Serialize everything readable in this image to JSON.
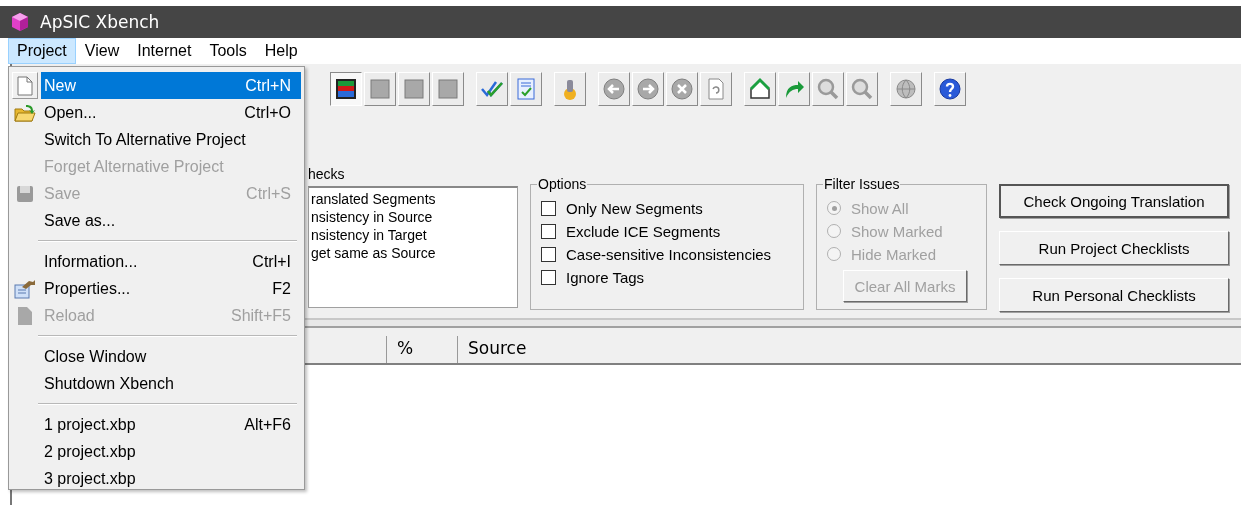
{
  "window": {
    "title": "ApSIC Xbench"
  },
  "menu_bar": [
    {
      "label": "Project",
      "selected": true
    },
    {
      "label": "View",
      "selected": false
    },
    {
      "label": "Internet",
      "selected": false
    },
    {
      "label": "Tools",
      "selected": false
    },
    {
      "label": "Help",
      "selected": false
    }
  ],
  "project_menu": [
    {
      "kind": "item",
      "label": "New",
      "shortcut": "Ctrl+N",
      "selected": true,
      "disabled": false
    },
    {
      "kind": "item",
      "label": "Open...",
      "shortcut": "Ctrl+O",
      "selected": false,
      "disabled": false
    },
    {
      "kind": "item",
      "label": "Switch To Alternative Project",
      "selected": false,
      "disabled": false
    },
    {
      "kind": "item",
      "label": "Forget Alternative Project",
      "selected": false,
      "disabled": true
    },
    {
      "kind": "item",
      "label": "Save",
      "shortcut": "Ctrl+S",
      "selected": false,
      "disabled": true
    },
    {
      "kind": "item",
      "label": "Save as...",
      "selected": false,
      "disabled": false
    },
    {
      "kind": "separator"
    },
    {
      "kind": "item",
      "label": "Information...",
      "shortcut": "Ctrl+I",
      "selected": false,
      "disabled": false
    },
    {
      "kind": "item",
      "label": "Properties...",
      "shortcut": "F2",
      "selected": false,
      "disabled": false
    },
    {
      "kind": "item",
      "label": "Reload",
      "shortcut": "Shift+F5",
      "selected": false,
      "disabled": true
    },
    {
      "kind": "separator"
    },
    {
      "kind": "item",
      "label": "Close Window",
      "selected": false,
      "disabled": false
    },
    {
      "kind": "item",
      "label": "Shutdown Xbench",
      "selected": false,
      "disabled": false
    },
    {
      "kind": "separator"
    },
    {
      "kind": "item",
      "label": "1 project.xbp",
      "shortcut": "Alt+F6",
      "selected": false,
      "disabled": false
    },
    {
      "kind": "item",
      "label": "2 project.xbp",
      "selected": false,
      "disabled": false
    },
    {
      "kind": "item",
      "label": "3 project.xbp",
      "selected": false,
      "disabled": false
    }
  ],
  "toolbar": [
    {
      "buttons": [
        {
          "selected": true
        },
        {
          "selected": false
        },
        {
          "selected": false
        },
        {
          "selected": false
        }
      ]
    },
    {
      "buttons": [
        {
          "selected": false
        },
        {
          "selected": false
        }
      ]
    },
    {
      "buttons": [
        {
          "selected": false
        }
      ]
    },
    {
      "buttons": [
        {
          "selected": false
        },
        {
          "selected": false
        },
        {
          "selected": false
        },
        {
          "selected": false
        }
      ]
    },
    {
      "buttons": [
        {
          "selected": false
        },
        {
          "selected": false
        },
        {
          "selected": false
        },
        {
          "selected": false
        }
      ]
    },
    {
      "buttons": [
        {
          "selected": false
        }
      ]
    },
    {
      "buttons": [
        {
          "selected": false
        }
      ]
    }
  ],
  "checks": {
    "label": "hecks",
    "items": [
      "ranslated Segments",
      "nsistency in Source",
      "nsistency in Target",
      "get same as Source"
    ]
  },
  "options": {
    "title": "Options",
    "items": [
      {
        "label": "Only New Segments",
        "checked": false
      },
      {
        "label": "Exclude ICE Segments",
        "checked": false
      },
      {
        "label": "Case-sensitive Inconsistencies",
        "checked": false
      },
      {
        "label": "Ignore Tags",
        "checked": false
      }
    ]
  },
  "filter_issues": {
    "title": "Filter Issues",
    "disabled": true,
    "options": [
      {
        "label": "Show All",
        "selected": true
      },
      {
        "label": "Show Marked",
        "selected": false
      },
      {
        "label": "Hide Marked",
        "selected": false
      }
    ],
    "clear_button": {
      "label": "Clear All Marks",
      "disabled": true
    }
  },
  "actions": [
    {
      "label": "Check Ongoing Translation",
      "default": true
    },
    {
      "label": "Run Project Checklists",
      "default": false
    },
    {
      "label": "Run Personal Checklists",
      "default": false
    }
  ],
  "table": {
    "columns": [
      {
        "label": "%"
      },
      {
        "label": "Source"
      }
    ]
  }
}
